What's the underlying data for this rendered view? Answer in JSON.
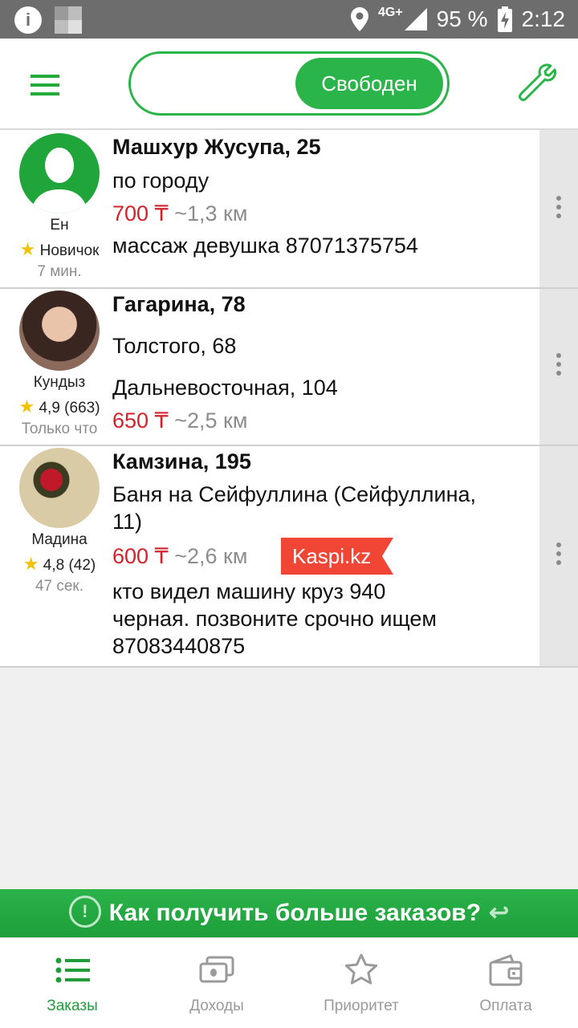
{
  "statusbar": {
    "network": "4G+",
    "battery": "95 %",
    "time": "2:12"
  },
  "header": {
    "status_label": "Свободен"
  },
  "orders": [
    {
      "passenger_name": "Ен",
      "rating_text": "Новичок",
      "time_ago": "7 мин.",
      "from": "Машхур Жусупа, 25",
      "to": "по городу",
      "price": "700 ₸",
      "distance": "~1,3 км",
      "comment": "массаж девушка 87071375754"
    },
    {
      "passenger_name": "Кундыз",
      "rating_text": "4,9 (663)",
      "time_ago": "Только что",
      "from": "Гагарина, 78",
      "stop": "Толстого, 68",
      "to": "Дальневосточная, 104",
      "price": "650 ₸",
      "distance": "~2,5 км"
    },
    {
      "passenger_name": "Мадина",
      "rating_text": "4,8 (42)",
      "time_ago": "47 сек.",
      "from": "Камзина, 195",
      "to_line1": "Баня на Сейфуллина (Сейфуллина,",
      "to_line2": "11)",
      "price": "600 ₸",
      "distance": "~2,6 км",
      "payment_badge": "Kaspi.kz",
      "comment_line1": "кто видел машину  круз 940",
      "comment_line2": "черная. позвоните срочно ищем",
      "comment_line3": "87083440875"
    }
  ],
  "promo": {
    "text": "Как получить больше заказов?"
  },
  "bottom_nav": [
    {
      "label": "Заказы",
      "icon": "list-icon",
      "active": true
    },
    {
      "label": "Доходы",
      "icon": "money-icon"
    },
    {
      "label": "Приоритет",
      "icon": "star-icon"
    },
    {
      "label": "Оплата",
      "icon": "wallet-icon"
    }
  ],
  "colors": {
    "accent": "#2bb44a",
    "price": "#d2232a",
    "kaspi": "#f14635"
  }
}
